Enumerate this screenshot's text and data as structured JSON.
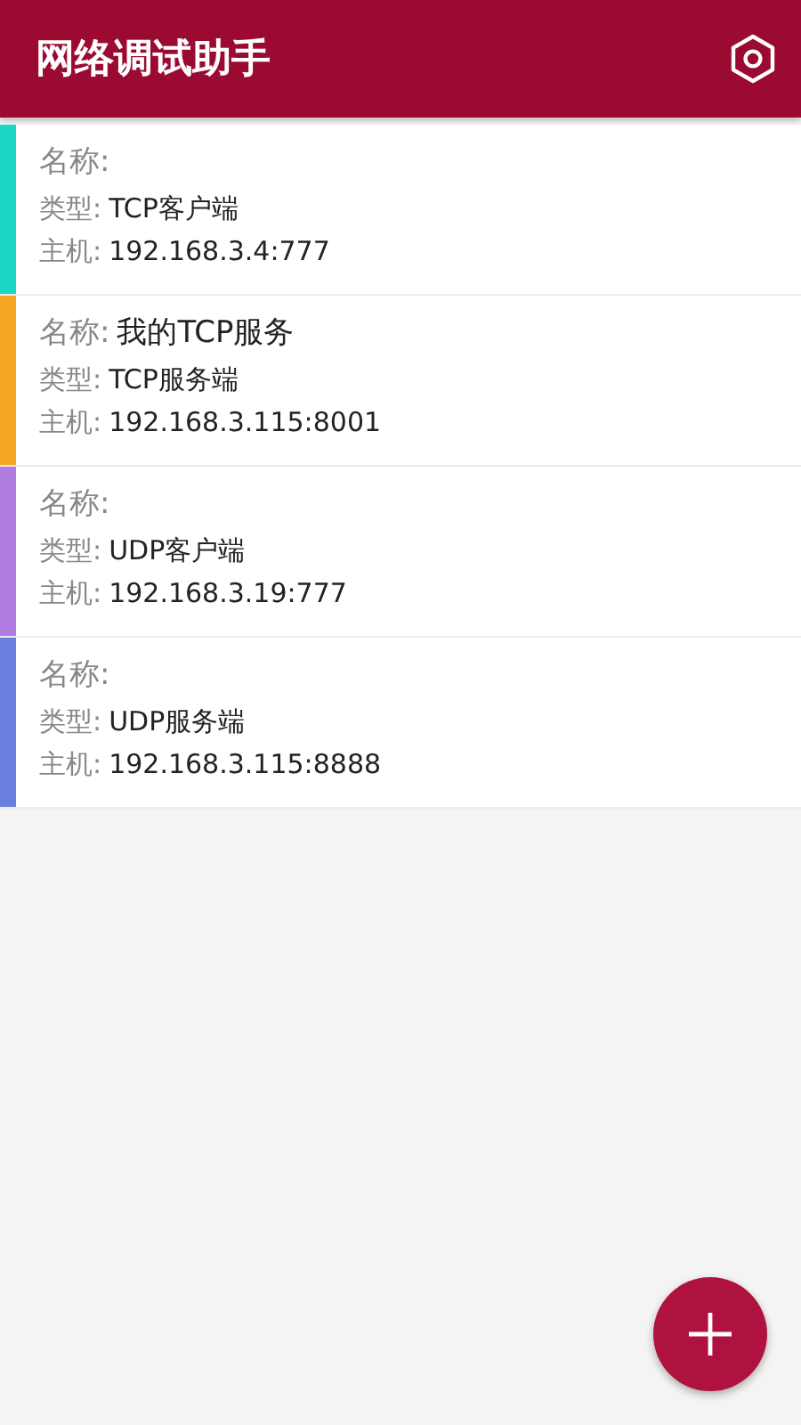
{
  "app_bar": {
    "title": "网络调试助手"
  },
  "connections": [
    {
      "color": "#1ad6c4",
      "name_label": "名称:",
      "type_label": "类型:",
      "type": "TCP客户端",
      "host_label": "主机:",
      "host": "192.168.3.4:777"
    },
    {
      "color": "#f5a623",
      "name_label": "名称:",
      "name": "我的TCP服务",
      "type_label": "类型:",
      "type": "TCP服务端",
      "host_label": "主机:",
      "host": "192.168.3.115:8001"
    },
    {
      "color": "#b07ee0",
      "name_label": "名称:",
      "type_label": "类型:",
      "type": "UDP客户端",
      "host_label": "主机:",
      "host": "192.168.3.19:777"
    },
    {
      "color": "#6a80e0",
      "name_label": "名称:",
      "type_label": "类型:",
      "type": "UDP服务端",
      "host_label": "主机:",
      "host": "192.168.3.115:8888"
    }
  ]
}
